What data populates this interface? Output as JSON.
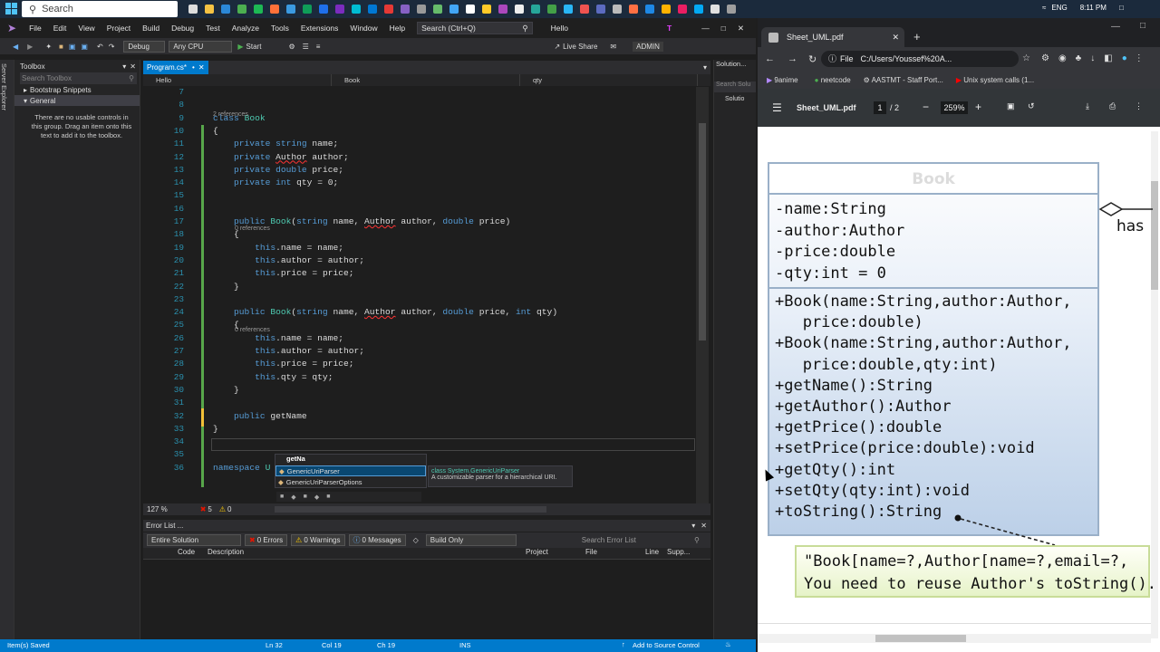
{
  "taskbar": {
    "search_label": "Search",
    "language": "ENG",
    "time": "8:11 PM"
  },
  "vs": {
    "menu": [
      "File",
      "Edit",
      "View",
      "Project",
      "Build",
      "Debug",
      "Test",
      "Analyze",
      "Tools",
      "Extensions",
      "Window",
      "Help"
    ],
    "search_placeholder": "Search (Ctrl+Q)",
    "solution_name": "Hello",
    "profile_initial": "T",
    "live_share": "Live Share",
    "admin": "ADMIN",
    "toolbar": {
      "config": "Debug",
      "platform": "Any CPU",
      "start": "Start"
    },
    "toolbox": {
      "title": "Toolbox",
      "search": "Search Toolbox",
      "group1": "Bootstrap Snippets",
      "group2": "General",
      "empty": "There are no usable controls in this group. Drag an item onto this text to add it to the toolbox."
    },
    "server_explorer": "Server Explorer",
    "tab": "Program.cs*",
    "nav": {
      "project": "Hello",
      "class": "Book",
      "member": "qty"
    },
    "code_lines": [
      {
        "n": "7",
        "t": ""
      },
      {
        "n": "8",
        "t": ""
      },
      {
        "n": "9",
        "t": "class Book"
      },
      {
        "n": "10",
        "t": "{"
      },
      {
        "n": "11",
        "t": "    private string name;"
      },
      {
        "n": "12",
        "t": "    private Author author;"
      },
      {
        "n": "13",
        "t": "    private double price;"
      },
      {
        "n": "14",
        "t": "    private int qty = 0;"
      },
      {
        "n": "15",
        "t": ""
      },
      {
        "n": "16",
        "t": ""
      },
      {
        "n": "17",
        "t": "    public Book(string name, Author author, double price)"
      },
      {
        "n": "18",
        "t": "    {"
      },
      {
        "n": "19",
        "t": "        this.name = name;"
      },
      {
        "n": "20",
        "t": "        this.author = author;"
      },
      {
        "n": "21",
        "t": "        this.price = price;"
      },
      {
        "n": "22",
        "t": "    }"
      },
      {
        "n": "23",
        "t": ""
      },
      {
        "n": "24",
        "t": "    public Book(string name, Author author, double price, int qty)"
      },
      {
        "n": "25",
        "t": "    {"
      },
      {
        "n": "26",
        "t": "        this.name = name;"
      },
      {
        "n": "27",
        "t": "        this.author = author;"
      },
      {
        "n": "28",
        "t": "        this.price = price;"
      },
      {
        "n": "29",
        "t": "        this.qty = qty;"
      },
      {
        "n": "30",
        "t": "    }"
      },
      {
        "n": "31",
        "t": ""
      },
      {
        "n": "32",
        "t": "    public getName"
      },
      {
        "n": "33",
        "t": "}"
      },
      {
        "n": "34",
        "t": ""
      },
      {
        "n": "35",
        "t": ""
      },
      {
        "n": "36",
        "t": "namespace U"
      }
    ],
    "refs": {
      "class": "2 references",
      "ctor1": "0 references",
      "ctor2": "0 references"
    },
    "autocomplete": {
      "typed": "getNa",
      "items": [
        "GenericUriParser",
        "GenericUriParserOptions"
      ],
      "tip_line1": "class System.GenericUriParser",
      "tip_line2": "A customizable parser for a hierarchical URI."
    },
    "zoom": "127 %",
    "err_count": "5",
    "warn_count": "0",
    "error_list": {
      "title": "Error List ...",
      "scope": "Entire Solution",
      "errors": "0 Errors",
      "warnings": "0 Warnings",
      "messages": "0 Messages",
      "build": "Build Only",
      "search": "Search Error List",
      "cols": [
        "Code",
        "Description",
        "Project",
        "File",
        "Line",
        "Supp..."
      ]
    },
    "solution_explorer": {
      "title": "Solution...",
      "search": "Search Solu",
      "item": "Solutio"
    },
    "status": {
      "left": "Item(s) Saved",
      "ln": "Ln 32",
      "col": "Col 19",
      "ch": "Ch 19",
      "ins": "INS",
      "source": "Add to Source Control"
    }
  },
  "chrome": {
    "tab_title": "Sheet_UML.pdf",
    "url_prefix": "File",
    "url": "C:/Users/Youssef%20A...",
    "bookmarks": [
      "9anime",
      "neetcode",
      "AASTMT - Staff Port...",
      "Unix system calls (1..."
    ],
    "pdf": {
      "name": "Sheet_UML.pdf",
      "page": "1",
      "pages": "/ 2",
      "zoom": "259%"
    }
  },
  "uml": {
    "class_name": "Book",
    "attributes": [
      "-name:String",
      "-author:Author",
      "-price:double",
      "-qty:int = 0"
    ],
    "methods": [
      "+Book(name:String,author:Author,",
      "   price:double)",
      "+Book(name:String,author:Author,",
      "   price:double,qty:int)",
      "+getName():String",
      "+getAuthor():Author",
      "+getPrice():double",
      "+setPrice(price:double):void",
      "+getQty():int",
      "+setQty(qty:int):void",
      "+toString():String"
    ],
    "relation": "has",
    "note_line1": "\"Book[name=?,Author[name=?,email=?,",
    "note_line2": "You need to reuse Author's toString()."
  },
  "colors": {
    "vs_accent": "#007acc",
    "keyword": "#569cd6",
    "type": "#4ec9b0",
    "line_number": "#2b91af"
  }
}
